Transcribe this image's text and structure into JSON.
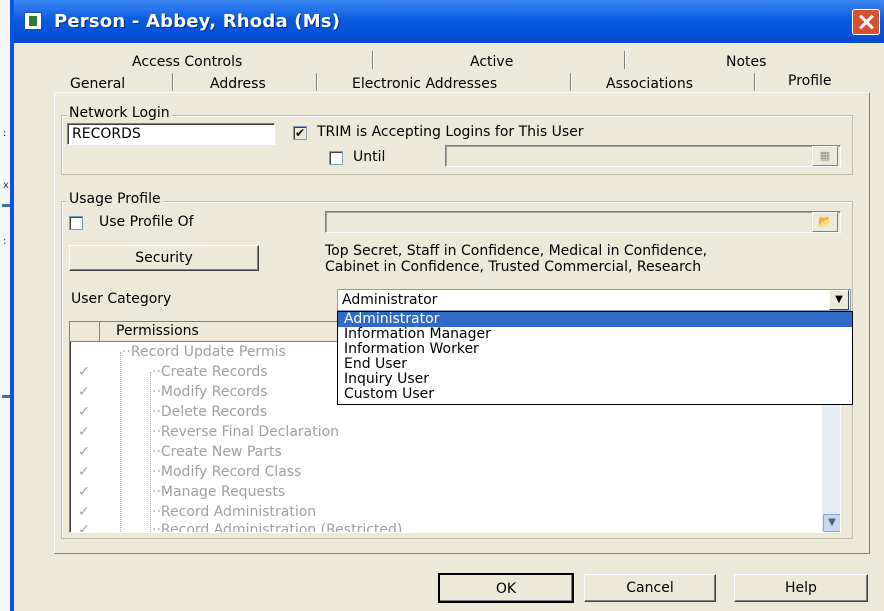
{
  "window": {
    "title": "Person - Abbey, Rhoda (Ms)"
  },
  "tabs": {
    "row1": [
      "Access Controls",
      "Active",
      "Notes"
    ],
    "row2": [
      "General",
      "Address",
      "Electronic Addresses",
      "Associations",
      "Profile"
    ],
    "active": "Profile"
  },
  "network_login": {
    "group_label": "Network Login",
    "login_value": "RECORDS",
    "accepting_label": "TRIM is Accepting Logins for This User",
    "accepting_checked": true,
    "until_label": "Until",
    "until_checked": false,
    "until_value": ""
  },
  "usage_profile": {
    "group_label": "Usage Profile",
    "use_profile_label": "Use Profile Of",
    "use_profile_checked": false,
    "security_button": "Security",
    "security_text_line1": "Top Secret, Staff in Confidence, Medical in Confidence,",
    "security_text_line2": "Cabinet in Confidence, Trusted Commercial, Research",
    "user_category_label": "User Category",
    "user_category_value": "Administrator",
    "category_options": [
      "Administrator",
      "Information Manager",
      "Information Worker",
      "End User",
      "Inquiry User",
      "Custom User"
    ],
    "permissions_header": "Permissions",
    "permissions": [
      "Record Update Permis",
      "Create Records",
      "Modify Records",
      "Delete Records",
      "Reverse Final Declaration",
      "Create New Parts",
      "Modify Record Class",
      "Manage Requests",
      "Record Administration",
      "Record Administration (Restricted)"
    ]
  },
  "buttons": {
    "ok": "OK",
    "cancel": "Cancel",
    "help": "Help"
  },
  "colors": {
    "title_bar": "#0a5ce0",
    "dialog_bg": "#ece9d8",
    "selection": "#316ac5",
    "close_button": "#d7512e"
  }
}
